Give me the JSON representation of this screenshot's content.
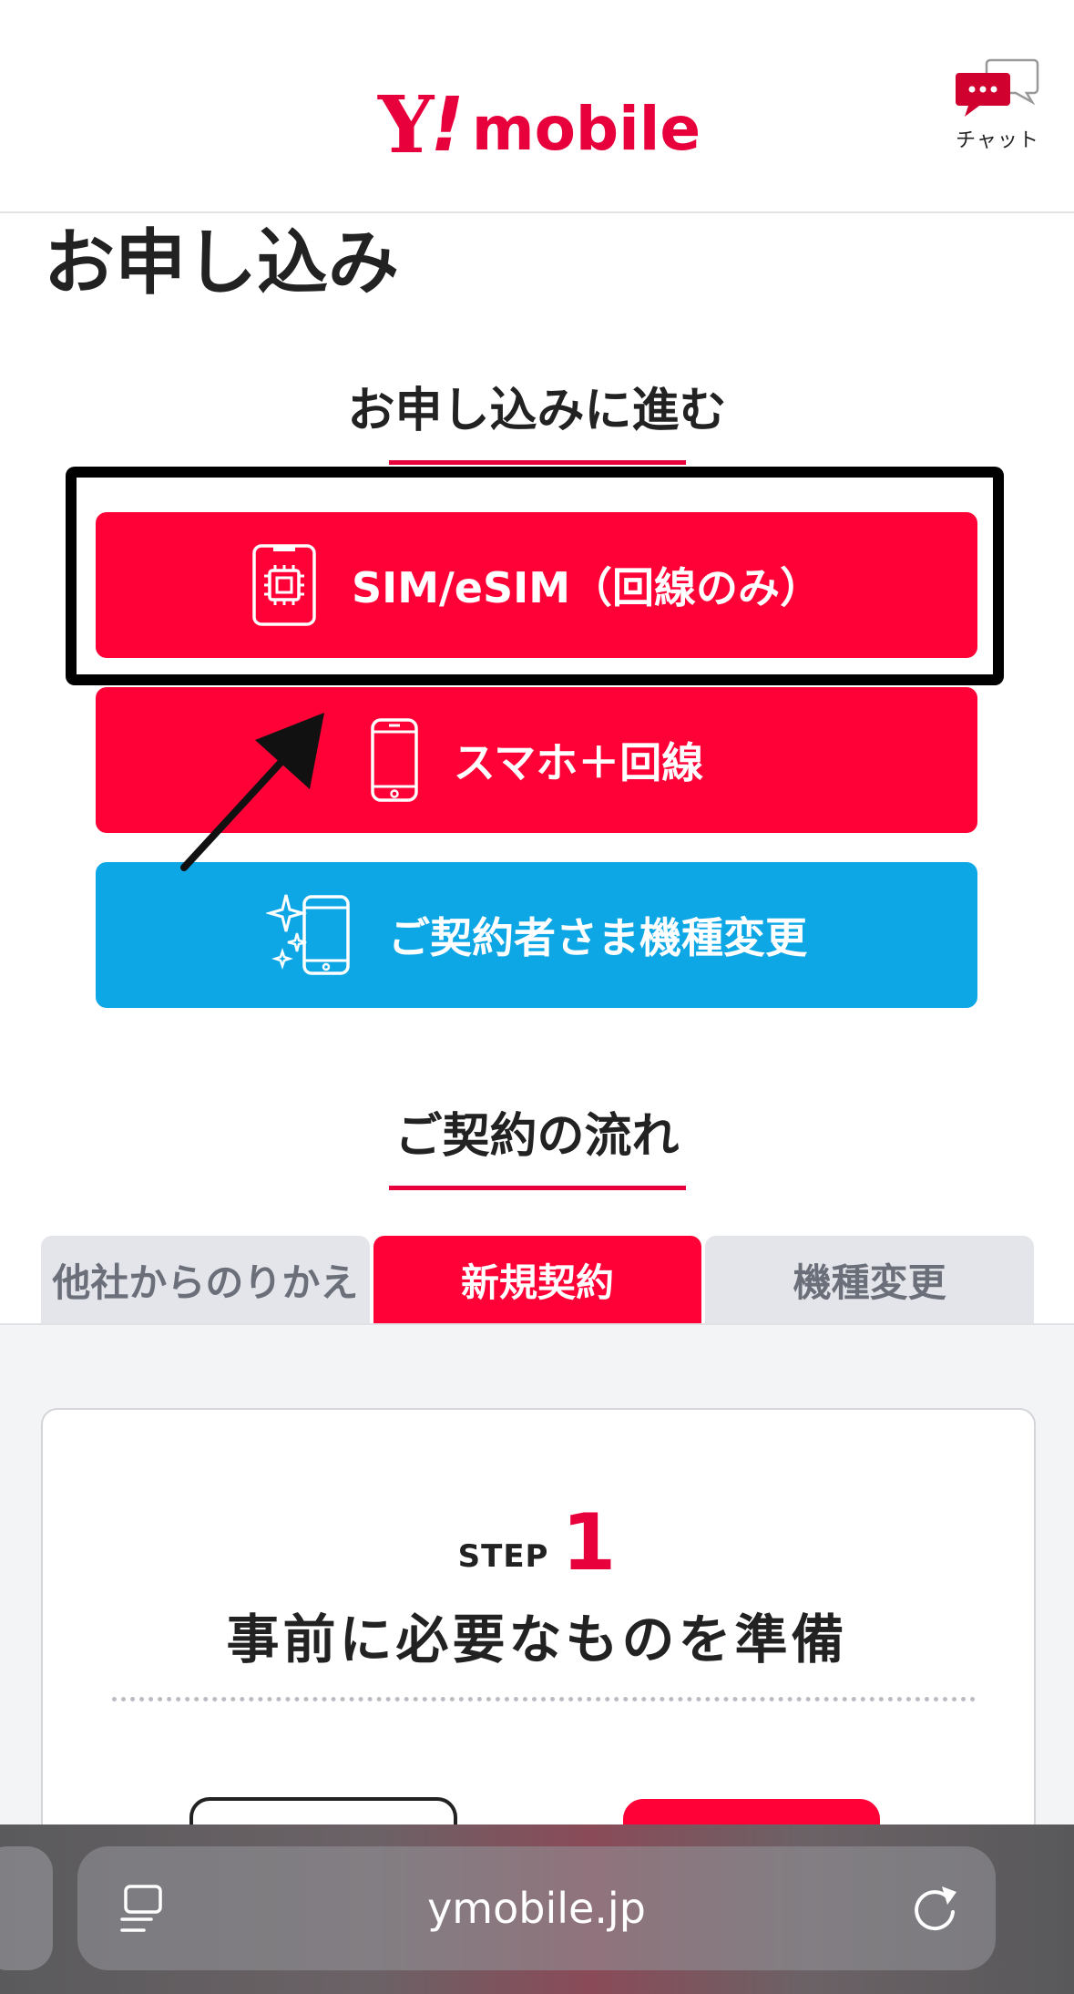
{
  "header": {
    "logo_y": "Y",
    "logo_excl": "!",
    "logo_word": "mobile",
    "chat_label": "チャット"
  },
  "page": {
    "title": "お申し込み"
  },
  "apply": {
    "heading": "お申し込みに進む",
    "buttons": [
      {
        "label": "SIM/eSIM（回線のみ）",
        "color": "#ff0037",
        "icon": "sim-card-icon"
      },
      {
        "label": "スマホ＋回線",
        "color": "#ff0037",
        "icon": "smartphone-icon"
      },
      {
        "label": "ご契約者さま機種変更",
        "color": "#0ea7e5",
        "icon": "sparkle-phone-icon"
      }
    ]
  },
  "flow": {
    "heading": "ご契約の流れ",
    "tabs": [
      {
        "label": "他社からのりかえ",
        "active": false
      },
      {
        "label": "新規契約",
        "active": true
      },
      {
        "label": "機種変更",
        "active": false
      }
    ]
  },
  "step": {
    "word": "STEP",
    "number": "1",
    "title": "事前に必要なものを準備"
  },
  "browser": {
    "url": "ymobile.jp"
  },
  "colors": {
    "brand_red": "#e8003d",
    "button_red": "#ff0037",
    "button_blue": "#0ea7e5"
  }
}
